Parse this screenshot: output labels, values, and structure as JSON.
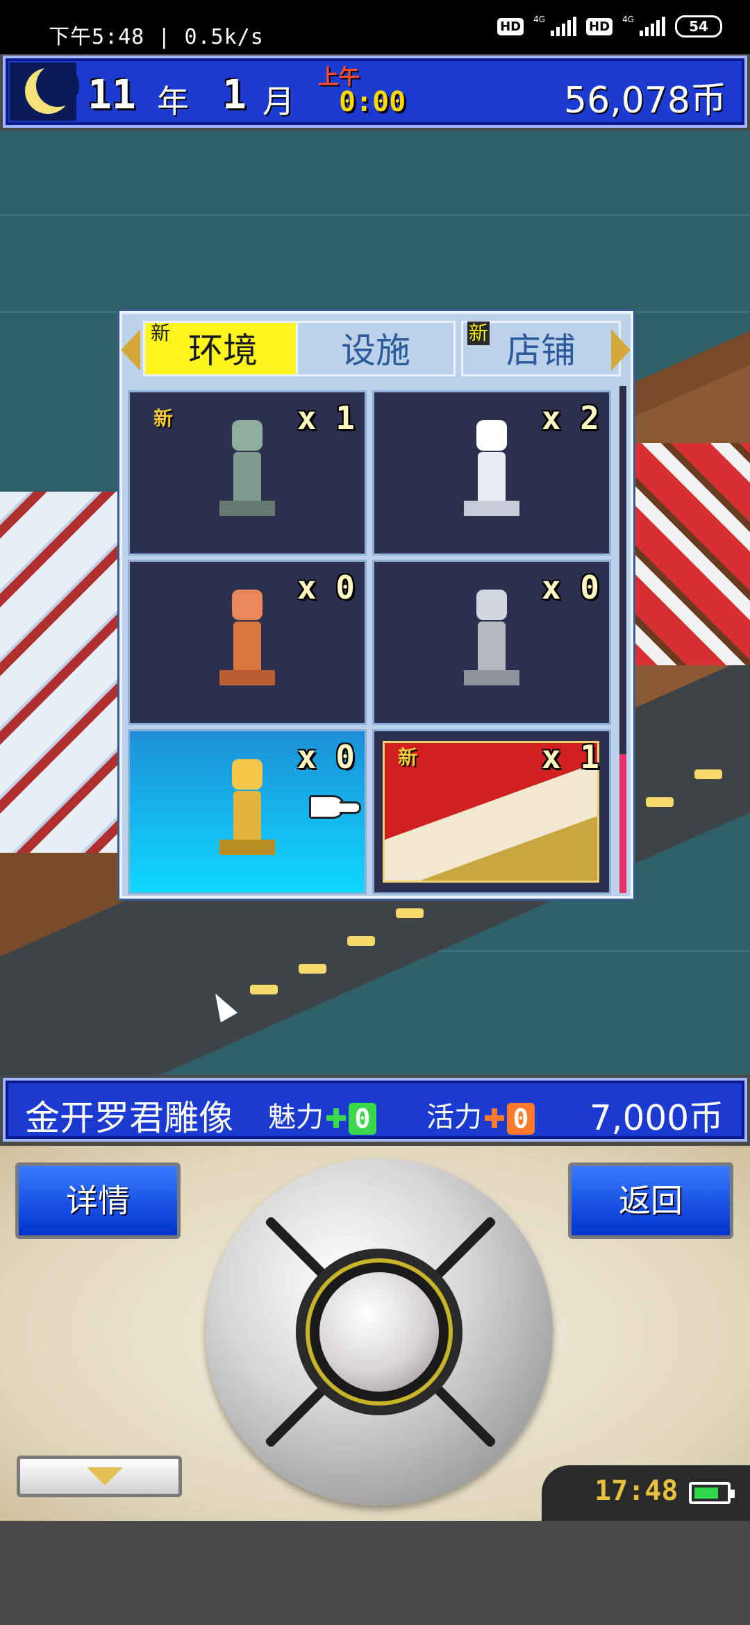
{
  "status_bar": {
    "time": "下午5:48",
    "speed": "0.5k/s",
    "hd1": "HD",
    "hd2": "HD",
    "net1": "4G",
    "net2": "4G",
    "battery": "54"
  },
  "hud": {
    "year": "11",
    "year_unit": "年",
    "month": "1",
    "month_unit": "月",
    "ampm": "上午",
    "clock": "0:00",
    "money": "56,078币"
  },
  "item_window": {
    "tabs": [
      {
        "label": "环境",
        "new": "新",
        "active": true
      },
      {
        "label": "设施",
        "new": "",
        "active": false
      },
      {
        "label": "店铺",
        "new": "新",
        "active": false
      }
    ],
    "items": [
      {
        "new": "新",
        "qty": "x 1",
        "color": "#7f9a8f"
      },
      {
        "new": "",
        "qty": "x 2",
        "color": "#e9ecf4"
      },
      {
        "new": "",
        "qty": "x 0",
        "color": "#d8763f"
      },
      {
        "new": "",
        "qty": "x 0",
        "color": "#b4b8c0"
      },
      {
        "new": "",
        "qty": "x 0",
        "color": "#e4b53c"
      },
      {
        "new": "新",
        "qty": "x 1",
        "color": "#d02020"
      }
    ],
    "selected_index": 4
  },
  "info_bar": {
    "name": "金开罗君雕像",
    "charm_label": "魅力",
    "charm_value": "0",
    "energy_label": "活力",
    "energy_value": "0",
    "price": "7,000币",
    "charm_color": "#3ad84a",
    "energy_color": "#ff7a2a"
  },
  "controller": {
    "detail_label": "详情",
    "back_label": "返回",
    "clock": "17:48"
  }
}
